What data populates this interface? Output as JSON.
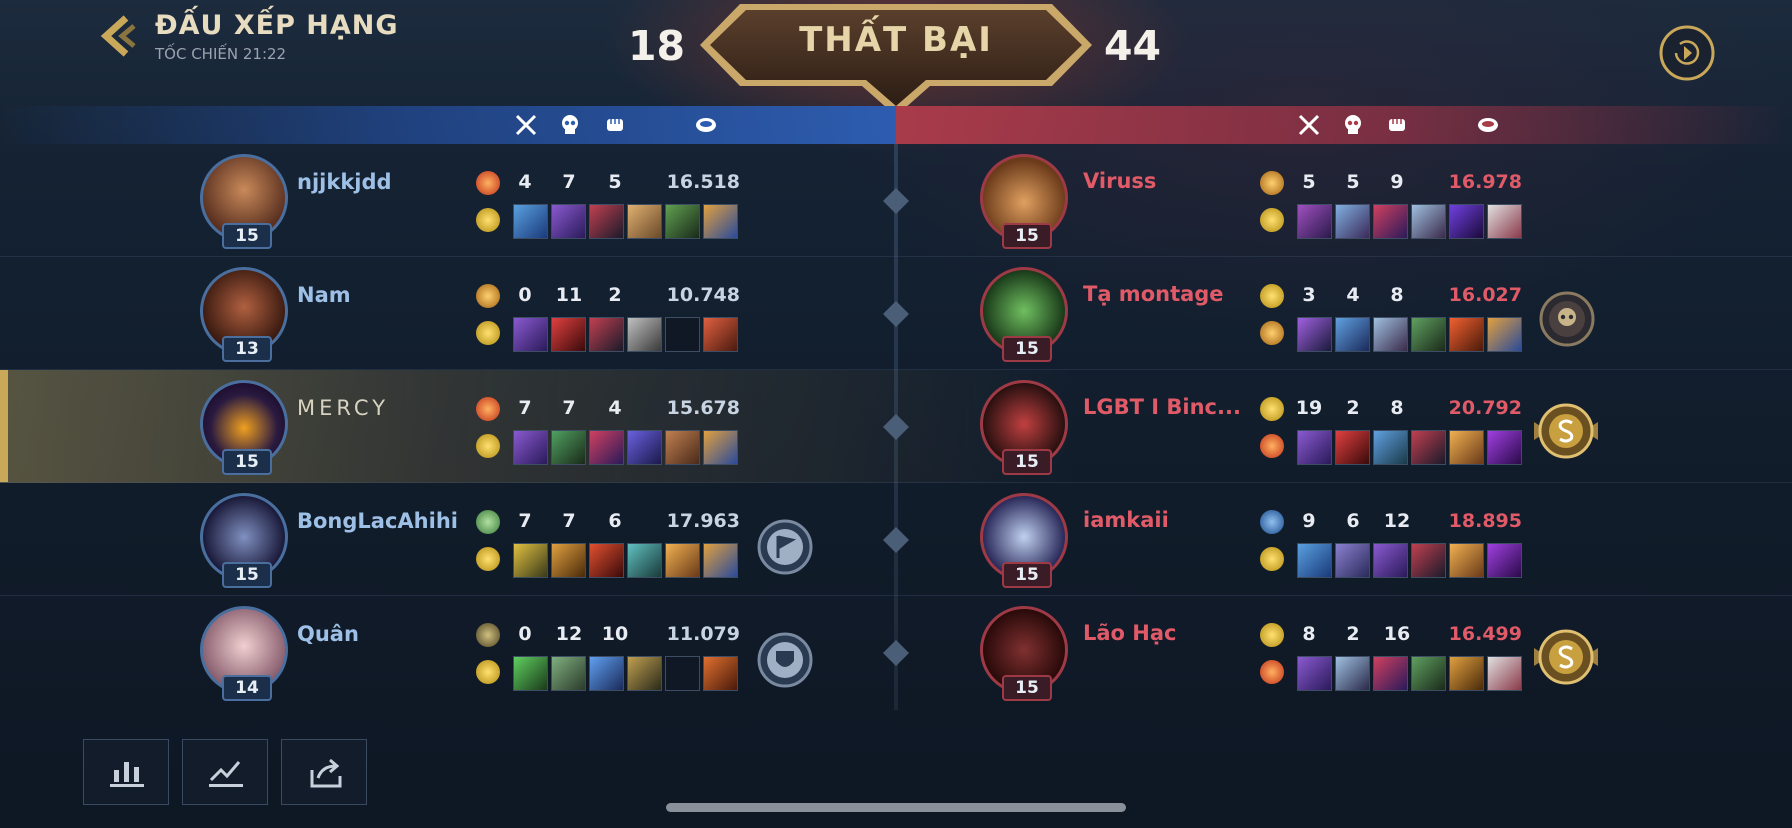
{
  "header": {
    "mode_title": "ĐẤU XẾP HẠNG",
    "mode_subtitle": "TỐC CHIẾN 21:22",
    "result": "THẤT BẠI",
    "score_left": "18",
    "score_right": "44"
  },
  "colors": {
    "blue_team": "#2d5cb0",
    "red_team": "#a93b4a",
    "gold_accent": "#c9a85a"
  },
  "column_icons": [
    "crossed-swords-icon",
    "skull-icon",
    "fist-icon",
    "coin-icon"
  ],
  "blue_team": [
    {
      "name": "njjkkjdd",
      "level": "15",
      "kills": "4",
      "deaths": "7",
      "assists": "5",
      "gold": "16.518"
    },
    {
      "name": "Nam",
      "level": "13",
      "kills": "0",
      "deaths": "11",
      "assists": "2",
      "gold": "10.748"
    },
    {
      "name": "MERCY",
      "level": "15",
      "kills": "7",
      "deaths": "7",
      "assists": "4",
      "gold": "15.678"
    },
    {
      "name": "BongLacAhihi",
      "level": "15",
      "kills": "7",
      "deaths": "7",
      "assists": "6",
      "gold": "17.963"
    },
    {
      "name": "Quân",
      "level": "14",
      "kills": "0",
      "deaths": "12",
      "assists": "10",
      "gold": "11.079"
    }
  ],
  "red_team": [
    {
      "name": "Viruss",
      "level": "15",
      "kills": "5",
      "deaths": "5",
      "assists": "9",
      "gold": "16.978"
    },
    {
      "name": "Tạ montage",
      "level": "15",
      "kills": "3",
      "deaths": "4",
      "assists": "8",
      "gold": "16.027"
    },
    {
      "name": "LGBT I Binc...",
      "level": "15",
      "kills": "19",
      "deaths": "2",
      "assists": "8",
      "gold": "20.792"
    },
    {
      "name": "iamkaii",
      "level": "15",
      "kills": "9",
      "deaths": "6",
      "assists": "12",
      "gold": "18.895"
    },
    {
      "name": "Lão Hạc",
      "level": "15",
      "kills": "8",
      "deaths": "2",
      "assists": "16",
      "gold": "16.499"
    }
  ],
  "bottom_buttons": [
    "stats-chart-icon",
    "trend-graph-icon",
    "share-icon"
  ]
}
